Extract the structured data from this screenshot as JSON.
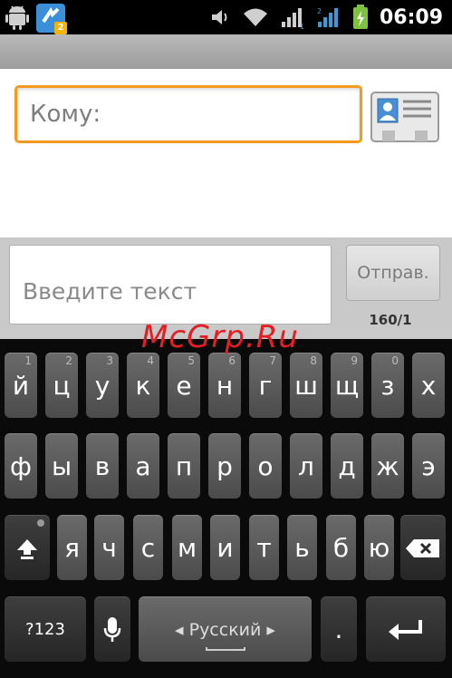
{
  "status_bar": {
    "time": "06:09",
    "notification_badge": "2",
    "icons": [
      "android-debug-icon",
      "app-notification-icon",
      "volume-icon",
      "wifi-icon",
      "signal-sim1-icon",
      "signal-sim2-icon",
      "battery-icon"
    ]
  },
  "compose": {
    "to_placeholder": "Кому:",
    "message_placeholder": "Введите текст",
    "send_label": "Отправ.",
    "counter": "160/1"
  },
  "watermark": "McGrp.Ru",
  "keyboard": {
    "row1": [
      {
        "label": "й",
        "num": "1"
      },
      {
        "label": "ц",
        "num": "2"
      },
      {
        "label": "у",
        "num": "3"
      },
      {
        "label": "к",
        "num": "4"
      },
      {
        "label": "е",
        "num": "5"
      },
      {
        "label": "н",
        "num": "6"
      },
      {
        "label": "г",
        "num": "7"
      },
      {
        "label": "ш",
        "num": "8"
      },
      {
        "label": "щ",
        "num": "9"
      },
      {
        "label": "з",
        "num": "0"
      },
      {
        "label": "х",
        "num": ""
      }
    ],
    "row2": [
      "ф",
      "ы",
      "в",
      "а",
      "п",
      "р",
      "о",
      "л",
      "д",
      "ж",
      "э"
    ],
    "row3": [
      "я",
      "ч",
      "с",
      "м",
      "и",
      "т",
      "ь",
      "б",
      "ю"
    ],
    "symbols_label": "?123",
    "language_label": "Русский",
    "period_label": "."
  },
  "colors": {
    "focus_border": "#f39a1f",
    "watermark": "#e31e24",
    "key_face": "#5a5a5a"
  }
}
